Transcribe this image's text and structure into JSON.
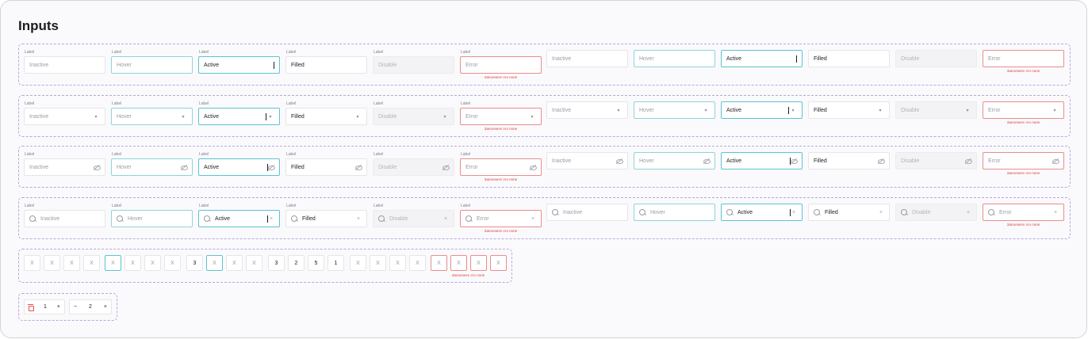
{
  "page_title": "Inputs",
  "label": "Label",
  "error_message": "Заполните это поле",
  "states": [
    "Inactive",
    "Hover",
    "Active",
    "Filled",
    "Disable",
    "Error"
  ],
  "rows": [
    {
      "name": "text-inputs",
      "tail": "none"
    },
    {
      "name": "select-inputs",
      "tail": "chevron"
    },
    {
      "name": "password-inputs",
      "tail": "eye"
    },
    {
      "name": "search-inputs",
      "tail": "clear"
    }
  ],
  "icons": {
    "chevron": "chevron-down-icon",
    "eye": "eye-off-icon",
    "search": "search-icon",
    "clear": "close-icon",
    "trash": "trash-icon",
    "minus": "minus-icon",
    "plus": "plus-icon"
  },
  "code_cells": [
    "X",
    "X",
    "X",
    "X",
    "X",
    "X",
    "X",
    "X",
    "3",
    "X",
    "X",
    "X",
    "3",
    "2",
    "5",
    "1",
    "X",
    "X",
    "X",
    "X",
    "X",
    "X",
    "X",
    "X"
  ],
  "stepper": {
    "first": {
      "value": "1",
      "minus": "−",
      "plus": "+"
    },
    "second": {
      "value": "2",
      "minus": "−",
      "plus": "+"
    }
  },
  "colors": {
    "active_border": "#5cc3d2",
    "hover_border": "#8fd3dc",
    "error_border": "#ec8c8c",
    "error_text": "#e03a3a",
    "dashed_border": "#b4a8de"
  }
}
